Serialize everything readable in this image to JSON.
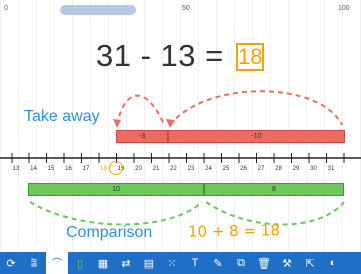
{
  "ruler": {
    "start": "0",
    "mid": "50",
    "end": "100"
  },
  "equation": {
    "text": "31 - 13 =",
    "answer": "18"
  },
  "labels": {
    "take_away": "Take away",
    "comparison": "Comparison",
    "handwritten": "10 + 8 = 18"
  },
  "bars": {
    "take_away": [
      {
        "label": "-3"
      },
      {
        "label": "-10"
      }
    ],
    "comparison": [
      {
        "label": "10"
      },
      {
        "label": "8"
      }
    ]
  },
  "number_line": {
    "ticks": [
      "13",
      "14",
      "15",
      "16",
      "17",
      "18",
      "19",
      "20",
      "21",
      "22",
      "23",
      "24",
      "25",
      "26",
      "27",
      "28",
      "29",
      "30",
      "31"
    ],
    "highlighted": "18"
  },
  "colors": {
    "take_away": "#ef6b62",
    "comparison": "#6cc85a",
    "accent": "#f0a400",
    "label_blue": "#2f8fdc",
    "toolbar": "#1f6fc6"
  },
  "toolbar": {
    "tools": [
      {
        "name": "refresh-icon",
        "glyph": "⟳"
      },
      {
        "name": "numberline-settings-icon",
        "glyph": "⩰"
      },
      {
        "name": "jump-arrow-icon",
        "glyph": "⌒"
      },
      {
        "name": "green-bar-icon",
        "glyph": "▯"
      },
      {
        "name": "grid-icon",
        "glyph": "▦"
      },
      {
        "name": "split-icon",
        "glyph": "⇄"
      },
      {
        "name": "table-icon",
        "glyph": "▤"
      },
      {
        "name": "dice-icon",
        "glyph": "⁙"
      },
      {
        "name": "text-icon",
        "glyph": "T"
      },
      {
        "name": "pencil-icon",
        "glyph": "✎"
      },
      {
        "name": "duplicate-icon",
        "glyph": "⧉"
      },
      {
        "name": "trash-icon",
        "glyph": "🗑"
      },
      {
        "name": "wrench-icon",
        "glyph": "⚒"
      },
      {
        "name": "export-icon",
        "glyph": "⇱"
      },
      {
        "name": "more-icon",
        "glyph": "◐"
      }
    ]
  }
}
